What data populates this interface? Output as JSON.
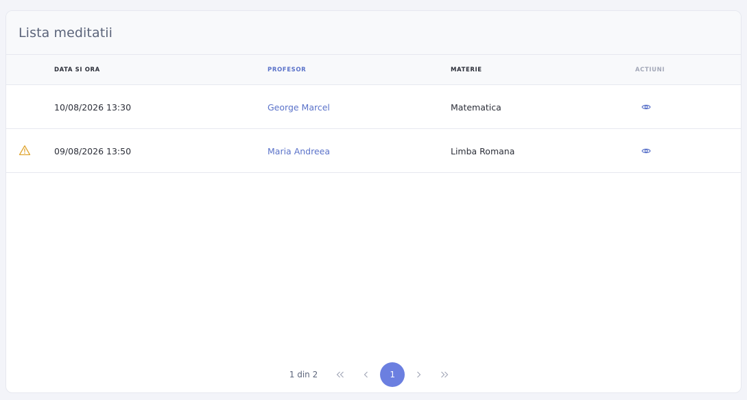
{
  "card": {
    "title": "Lista meditatii"
  },
  "columns": {
    "date": "DATA SI ORA",
    "professor": "PROFESOR",
    "subject": "MATERIE",
    "actions": "ACTIUNI"
  },
  "rows": [
    {
      "warning": false,
      "date": "10/08/2026 13:30",
      "professor": "George Marcel",
      "subject": "Matematica",
      "action_icon": "eye-icon"
    },
    {
      "warning": true,
      "date": "09/08/2026 13:50",
      "professor": "Maria Andreea",
      "subject": "Limba Romana",
      "action_icon": "eye-icon"
    }
  ],
  "pagination": {
    "info": "1 din 2",
    "current_page": "1",
    "first_icon": "double-chevron-left-icon",
    "prev_icon": "chevron-left-icon",
    "next_icon": "chevron-right-icon",
    "last_icon": "double-chevron-right-icon"
  },
  "colors": {
    "accent": "#6b7fe0",
    "link": "#5a72c9",
    "warning": "#e0a530",
    "header_bg": "#f8f9fb"
  }
}
